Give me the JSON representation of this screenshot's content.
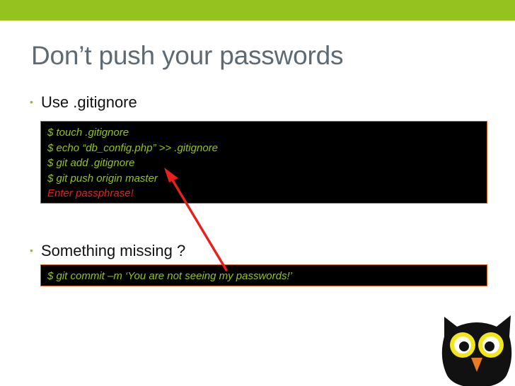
{
  "slide": {
    "title": "Don’t push your passwords",
    "accent_color": "#95c21f",
    "bullets": [
      {
        "label": "Use .gitignore"
      },
      {
        "label": "Something missing ?"
      }
    ],
    "terminal_1": {
      "lines": [
        "$ touch .gitignore",
        "$ echo “db_config.php” >> .gitignore",
        "$ git add .gitignore",
        "$ git push origin master",
        "Enter passphrase!"
      ]
    },
    "terminal_2": {
      "lines": [
        "$ git commit –m ‘You are not seeing my passwords!’"
      ]
    },
    "colors": {
      "terminal_text": "#95c21f",
      "error_text": "#e8201d",
      "terminal_border": "#d35f1e",
      "arrow": "#e8201d",
      "title": "#5d6a73"
    },
    "icons": [
      "owl-mascot-icon",
      "red-arrow-annotation"
    ]
  }
}
